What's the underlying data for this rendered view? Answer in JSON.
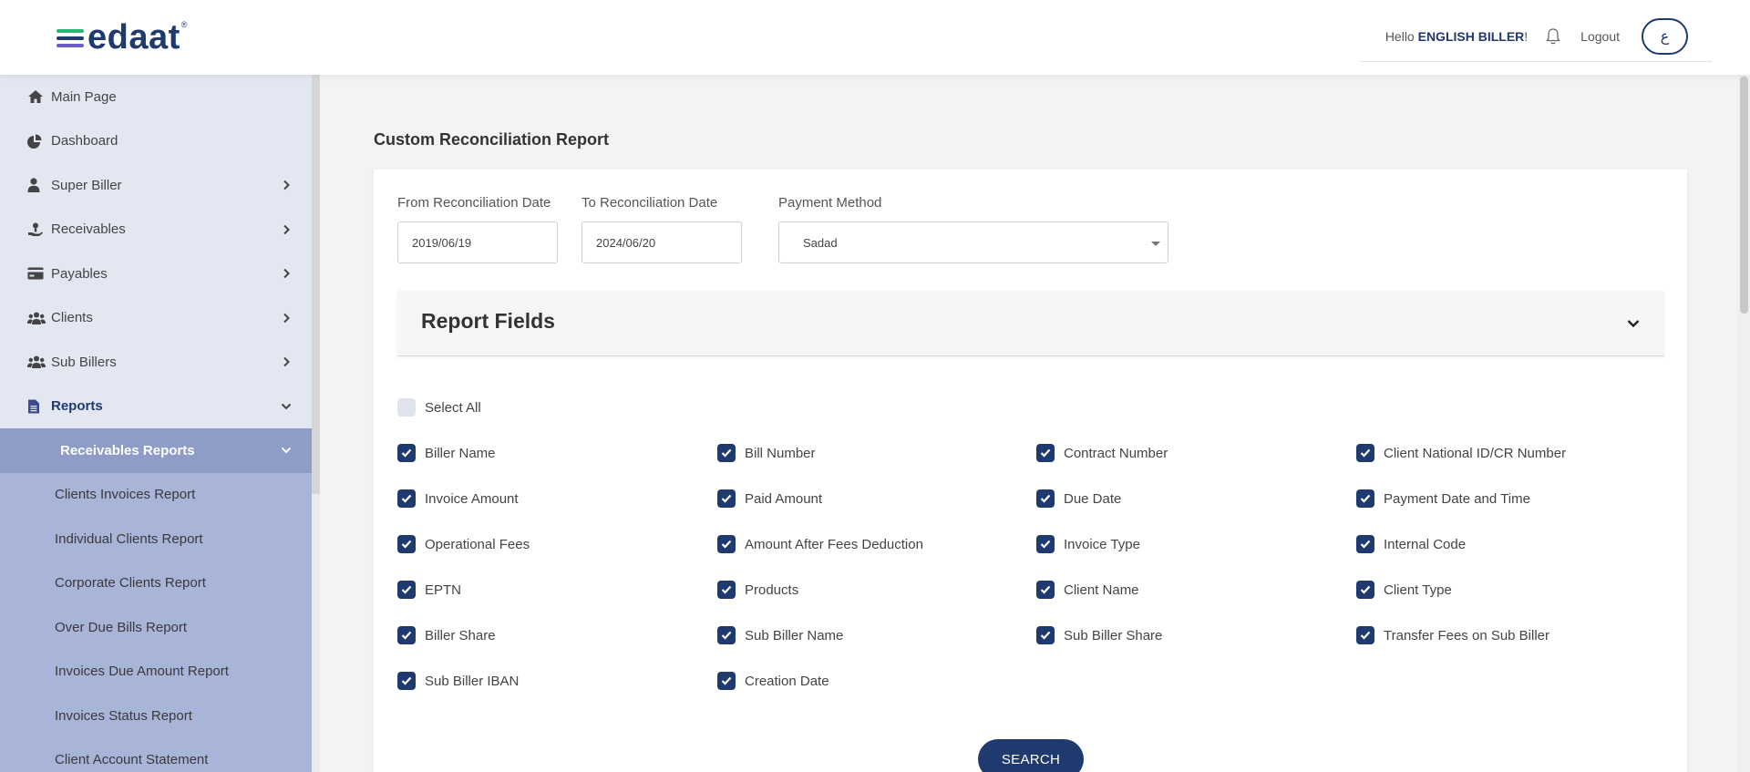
{
  "brand": {
    "name": "edaat",
    "tm": "®"
  },
  "header": {
    "greeting": "Hello",
    "user_name": "ENGLISH BILLER",
    "greeting_suffix": "!",
    "logout_label": "Logout",
    "language_toggle": "ع"
  },
  "sidebar": {
    "items": [
      {
        "label": "Main Page",
        "icon": "home-icon"
      },
      {
        "label": "Dashboard",
        "icon": "pie-chart-icon"
      },
      {
        "label": "Super Biller",
        "icon": "user-icon"
      },
      {
        "label": "Receivables",
        "icon": "hand-coin-icon"
      },
      {
        "label": "Payables",
        "icon": "credit-card-icon"
      },
      {
        "label": "Clients",
        "icon": "users-icon"
      },
      {
        "label": "Sub Billers",
        "icon": "users-icon"
      },
      {
        "label": "Reports",
        "icon": "document-icon"
      }
    ],
    "submenu_label": "Receivables Reports",
    "submenu_items": [
      "Clients Invoices Report",
      "Individual Clients Report",
      "Corporate Clients Report",
      "Over Due Bills Report",
      "Invoices Due Amount Report",
      "Invoices Status Report",
      "Client Account Statement"
    ]
  },
  "page": {
    "title": "Custom Reconciliation Report",
    "from_label": "From Reconciliation Date",
    "from_value": "2019/06/19",
    "to_label": "To Reconciliation Date",
    "to_value": "2024/06/20",
    "payment_label": "Payment Method",
    "payment_value": "Sadad",
    "report_fields_title": "Report Fields",
    "select_all_label": "Select All",
    "fields": [
      "Biller Name",
      "Bill Number",
      "Contract Number",
      "Client National ID/CR Number",
      "Invoice Amount",
      "Paid Amount",
      "Due Date",
      "Payment Date and Time",
      "Operational Fees",
      "Amount After Fees Deduction",
      "Invoice Type",
      "Internal Code",
      "EPTN",
      "Products",
      "Client Name",
      "Client Type",
      "Biller Share",
      "Sub Biller Name",
      "Sub Biller Share",
      "Transfer Fees on Sub Biller",
      "Sub Biller IBAN",
      "Creation Date"
    ],
    "search_label": "SEARCH"
  },
  "colors": {
    "primary": "#1f3a6e",
    "sidebar_bg": "#e3e7f1",
    "submenu_bg": "#a8b4d8",
    "submenu_header_bg": "#8e9dc7"
  }
}
